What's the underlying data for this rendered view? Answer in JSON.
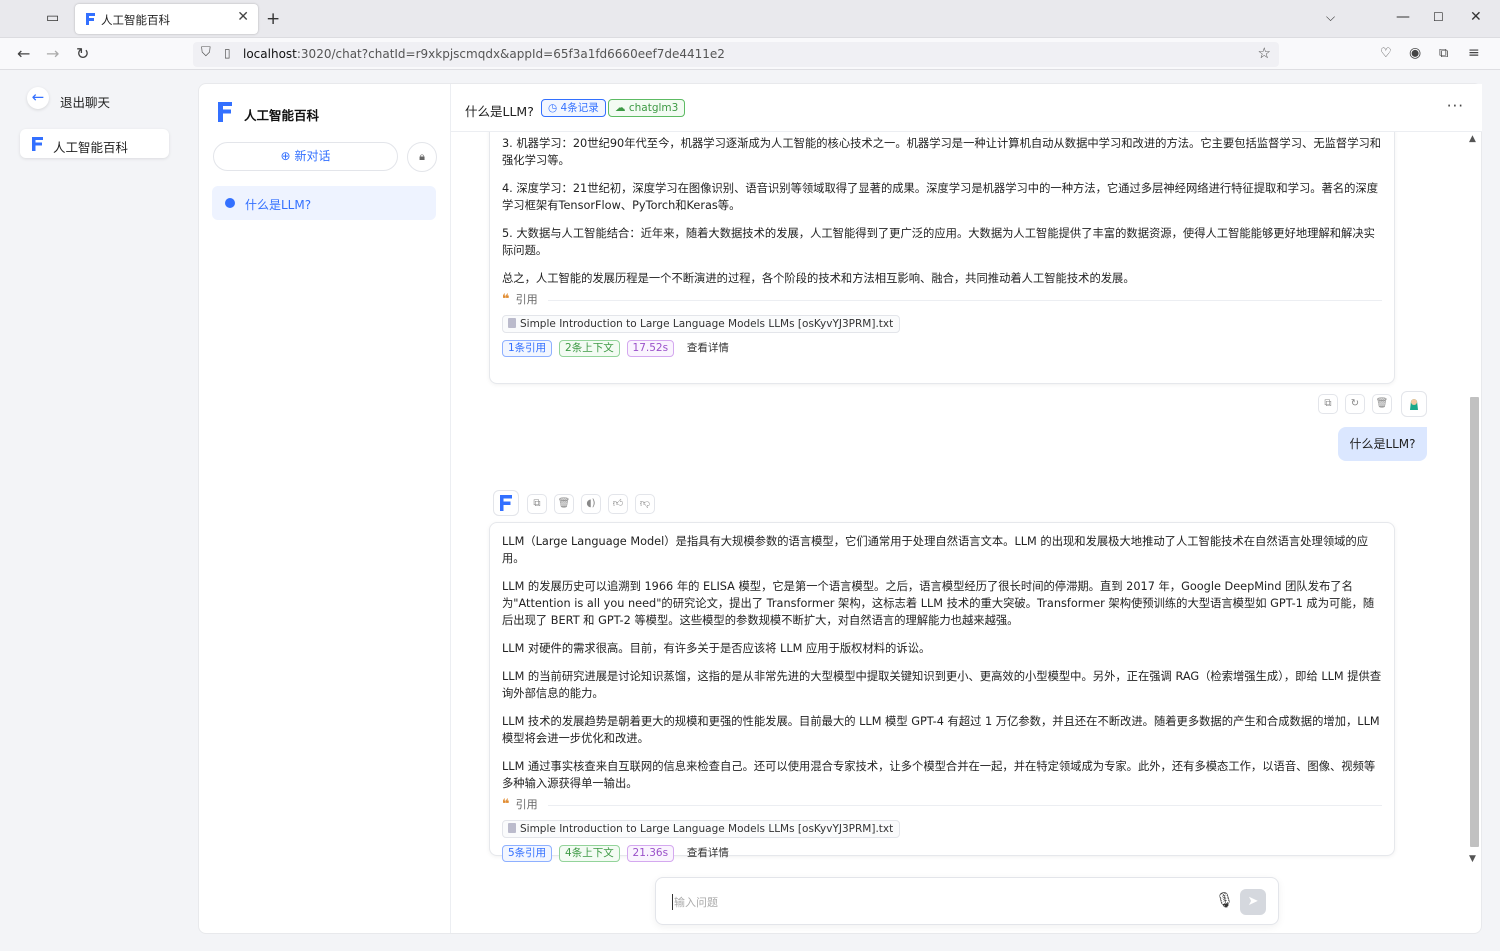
{
  "browser": {
    "tab_title": "人工智能百科",
    "url_host": "localhost",
    "url_rest": ":3020/chat?chatId=r9xkpjscmqdx&appId=65f3a1fd6660eef7de4411e2",
    "new_tab_symbol": "+"
  },
  "app": {
    "back_label": "退出聊天",
    "app_name": "人工智能百科",
    "sidebar_title": "人工智能百科",
    "new_chat_label": "新对话",
    "history": [
      {
        "label": "什么是LLM?"
      }
    ]
  },
  "chat_header": {
    "title": "什么是LLM?",
    "records_badge": "4条记录",
    "model_badge": "chatglm3"
  },
  "messages": {
    "first_answer": {
      "paragraphs": [
        "3. 机器学习：20世纪90年代至今，机器学习逐渐成为人工智能的核心技术之一。机器学习是一种让计算机自动从数据中学习和改进的方法。它主要包括监督学习、无监督学习和强化学习等。",
        "4. 深度学习：21世纪初，深度学习在图像识别、语音识别等领域取得了显著的成果。深度学习是机器学习中的一种方法，它通过多层神经网络进行特征提取和学习。著名的深度学习框架有TensorFlow、PyTorch和Keras等。",
        "5. 大数据与人工智能结合：近年来，随着大数据技术的发展，人工智能得到了更广泛的应用。大数据为人工智能提供了丰富的数据资源，使得人工智能能够更好地理解和解决实际问题。",
        "总之，人工智能的发展历程是一个不断演进的过程，各个阶段的技术和方法相互影响、融合，共同推动着人工智能技术的发展。"
      ],
      "quote_label": "引用",
      "source_file": "Simple Introduction to Large Language Models LLMs [osKyvYJ3PRM].txt",
      "tag_refs": "1条引用",
      "tag_context": "2条上下文",
      "tag_time": "17.52s",
      "tag_detail": "查看详情"
    },
    "user_question": "什么是LLM?",
    "second_answer": {
      "paragraphs": [
        "LLM（Large Language Model）是指具有大规模参数的语言模型，它们通常用于处理自然语言文本。LLM 的出现和发展极大地推动了人工智能技术在自然语言处理领域的应用。",
        "LLM 的发展历史可以追溯到 1966 年的 ELISA 模型，它是第一个语言模型。之后，语言模型经历了很长时间的停滞期。直到 2017 年，Google DeepMind 团队发布了名为\"Attention is all you need\"的研究论文，提出了 Transformer 架构，这标志着 LLM 技术的重大突破。Transformer 架构使预训练的大型语言模型如 GPT-1 成为可能，随后出现了 BERT 和 GPT-2 等模型。这些模型的参数规模不断扩大，对自然语言的理解能力也越来越强。",
        "LLM 对硬件的需求很高。目前，有许多关于是否应该将 LLM 应用于版权材料的诉讼。",
        "LLM 的当前研究进展是讨论知识蒸馏，这指的是从非常先进的大型模型中提取关键知识到更小、更高效的小型模型中。另外，正在强调 RAG（检索增强生成），即给 LLM 提供查询外部信息的能力。",
        "LLM 技术的发展趋势是朝着更大的规模和更强的性能发展。目前最大的 LLM 模型 GPT-4 有超过 1 万亿参数，并且还在不断改进。随着更多数据的产生和合成数据的增加，LLM 模型将会进一步优化和改进。",
        "LLM 通过事实核查来自互联网的信息来检查自己。还可以使用混合专家技术，让多个模型合并在一起，并在特定领域成为专家。此外，还有多模态工作，以语音、图像、视频等多种输入源获得单一输出。"
      ],
      "quote_label": "引用",
      "source_file": "Simple Introduction to Large Language Models LLMs [osKyvYJ3PRM].txt",
      "tag_refs": "5条引用",
      "tag_context": "4条上下文",
      "tag_time": "21.36s",
      "tag_detail": "查看详情"
    }
  },
  "input": {
    "placeholder": "输入问题"
  },
  "colors": {
    "accent": "#3370ff",
    "user_bubble": "#dbe7ff"
  }
}
